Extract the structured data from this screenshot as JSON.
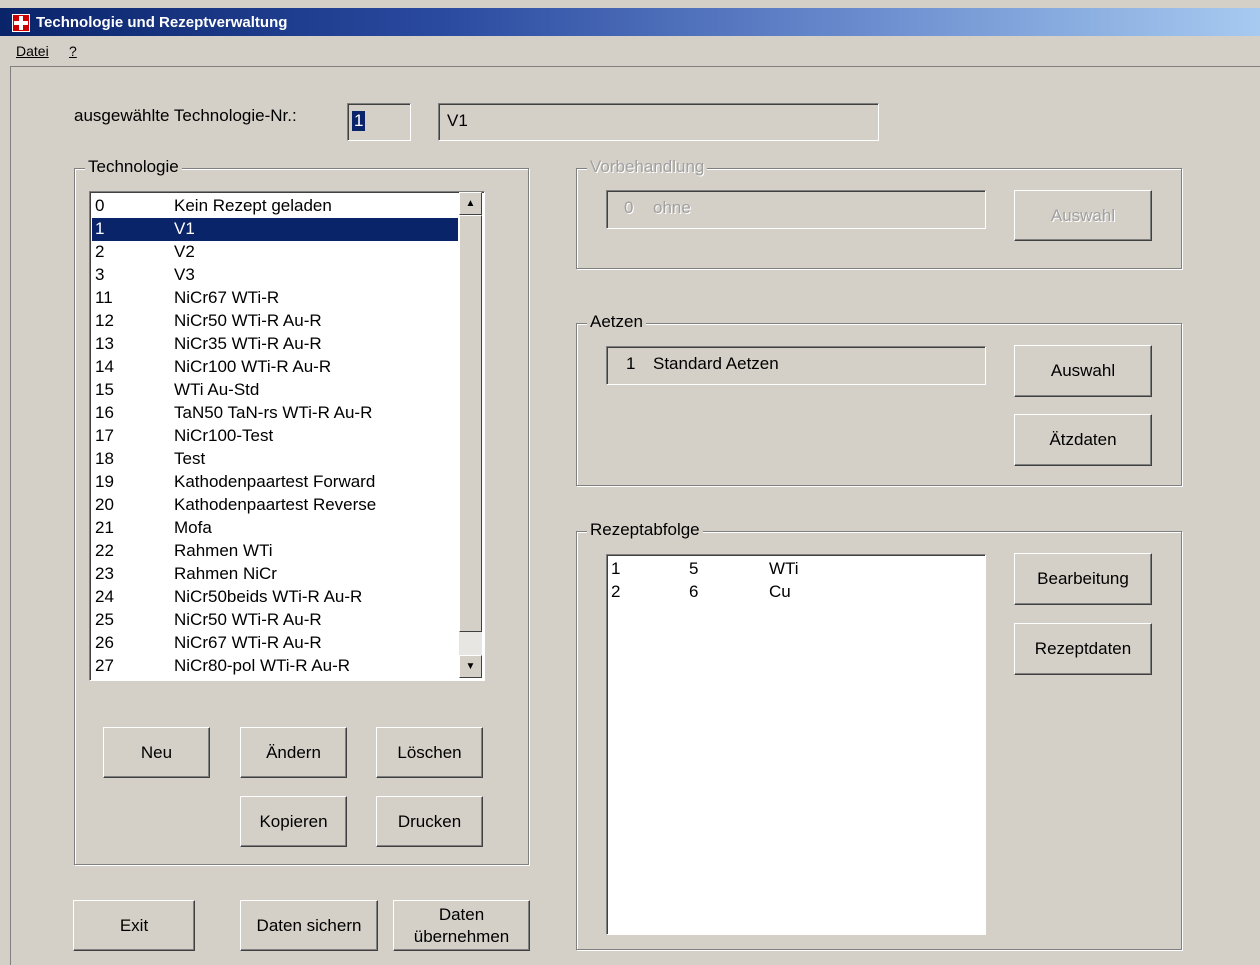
{
  "window": {
    "title": "Technologie und Rezeptverwaltung"
  },
  "menu": {
    "items": [
      "Datei",
      "?"
    ]
  },
  "selected": {
    "label": "ausgewählte Technologie-Nr.:",
    "number": "1",
    "name": "V1"
  },
  "technologie": {
    "title": "Technologie",
    "selected_index": 1,
    "items": [
      {
        "nr": "0",
        "name": "Kein Rezept geladen"
      },
      {
        "nr": "1",
        "name": "V1"
      },
      {
        "nr": "2",
        "name": "V2"
      },
      {
        "nr": "3",
        "name": "V3"
      },
      {
        "nr": "11",
        "name": "NiCr67 WTi-R"
      },
      {
        "nr": "12",
        "name": "NiCr50 WTi-R Au-R"
      },
      {
        "nr": "13",
        "name": "NiCr35 WTi-R Au-R"
      },
      {
        "nr": "14",
        "name": "NiCr100 WTi-R Au-R"
      },
      {
        "nr": "15",
        "name": "WTi Au-Std"
      },
      {
        "nr": "16",
        "name": "TaN50 TaN-rs WTi-R Au-R"
      },
      {
        "nr": "17",
        "name": "NiCr100-Test"
      },
      {
        "nr": "18",
        "name": "Test"
      },
      {
        "nr": "19",
        "name": "Kathodenpaartest Forward"
      },
      {
        "nr": "20",
        "name": "Kathodenpaartest Reverse"
      },
      {
        "nr": "21",
        "name": "Mofa"
      },
      {
        "nr": "22",
        "name": "Rahmen WTi"
      },
      {
        "nr": "23",
        "name": "Rahmen NiCr"
      },
      {
        "nr": "24",
        "name": "NiCr50beids WTi-R Au-R"
      },
      {
        "nr": "25",
        "name": "NiCr50 WTi-R Au-R"
      },
      {
        "nr": "26",
        "name": "NiCr67 WTi-R Au-R"
      },
      {
        "nr": "27",
        "name": "NiCr80-pol WTi-R Au-R"
      }
    ],
    "buttons": {
      "neu": "Neu",
      "aendern": "Ändern",
      "loeschen": "Löschen",
      "kopieren": "Kopieren",
      "drucken": "Drucken"
    }
  },
  "vorbehandlung": {
    "title": "Vorbehandlung",
    "nr": "0",
    "value": "ohne",
    "button": "Auswahl"
  },
  "aetzen": {
    "title": "Aetzen",
    "nr": "1",
    "value": "Standard Aetzen",
    "button_auswahl": "Auswahl",
    "button_aetzdaten": "Ätzdaten"
  },
  "rezeptabfolge": {
    "title": "Rezeptabfolge",
    "rows": [
      {
        "pos": "1",
        "rezept": "5",
        "name": "WTi"
      },
      {
        "pos": "2",
        "rezept": "6",
        "name": "Cu"
      }
    ],
    "button_bearbeitung": "Bearbeitung",
    "button_rezeptdaten": "Rezeptdaten"
  },
  "bottom": {
    "exit": "Exit",
    "sichern": "Daten sichern",
    "uebernehmen_1": "Daten",
    "uebernehmen_2": "übernehmen"
  },
  "colors": {
    "face": "#d4d0c8",
    "selection": "#0a246a",
    "titlebar_start": "#0a246a",
    "titlebar_end": "#a6caf0"
  }
}
